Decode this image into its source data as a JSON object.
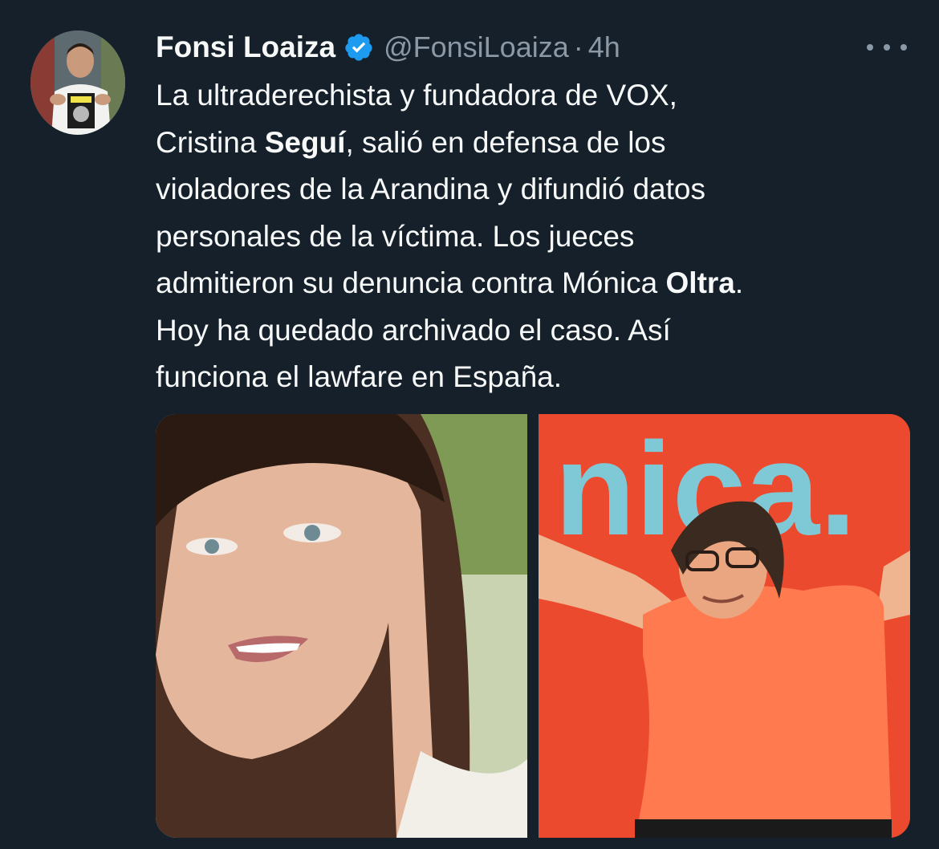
{
  "tweet": {
    "author_name": "Fonsi Loaiza",
    "handle": "@FonsiLoaiza",
    "separator": "·",
    "time": "4h",
    "text_lines": [
      {
        "before": "La ultraderechista y fundadora de VOX,",
        "bold": "",
        "after": ""
      },
      {
        "before": "Cristina ",
        "bold": "Seguí",
        "after": ", salió en defensa de los"
      },
      {
        "before": "violadores de la Arandina y difundió datos",
        "bold": "",
        "after": ""
      },
      {
        "before": "personales de la víctima. Los jueces",
        "bold": "",
        "after": ""
      },
      {
        "before": "admitieron su denuncia contra Mónica ",
        "bold": "Oltra",
        "after": "."
      },
      {
        "before": "Hoy ha quedado archivado el caso. Así",
        "bold": "",
        "after": ""
      },
      {
        "before": "funciona el lawfare en España.",
        "bold": "",
        "after": ""
      }
    ],
    "right_photo_sign_text": "nica."
  },
  "icons": {
    "verified": "verified-badge-icon",
    "more": "more-options-icon"
  },
  "colors": {
    "background": "#15202b",
    "primary_text": "#f7f9f9",
    "secondary_text": "#8b98a5",
    "verified_blue": "#1d9bf0",
    "sign_red": "#ec4a2e",
    "sign_letters": "#7fc9d6"
  }
}
